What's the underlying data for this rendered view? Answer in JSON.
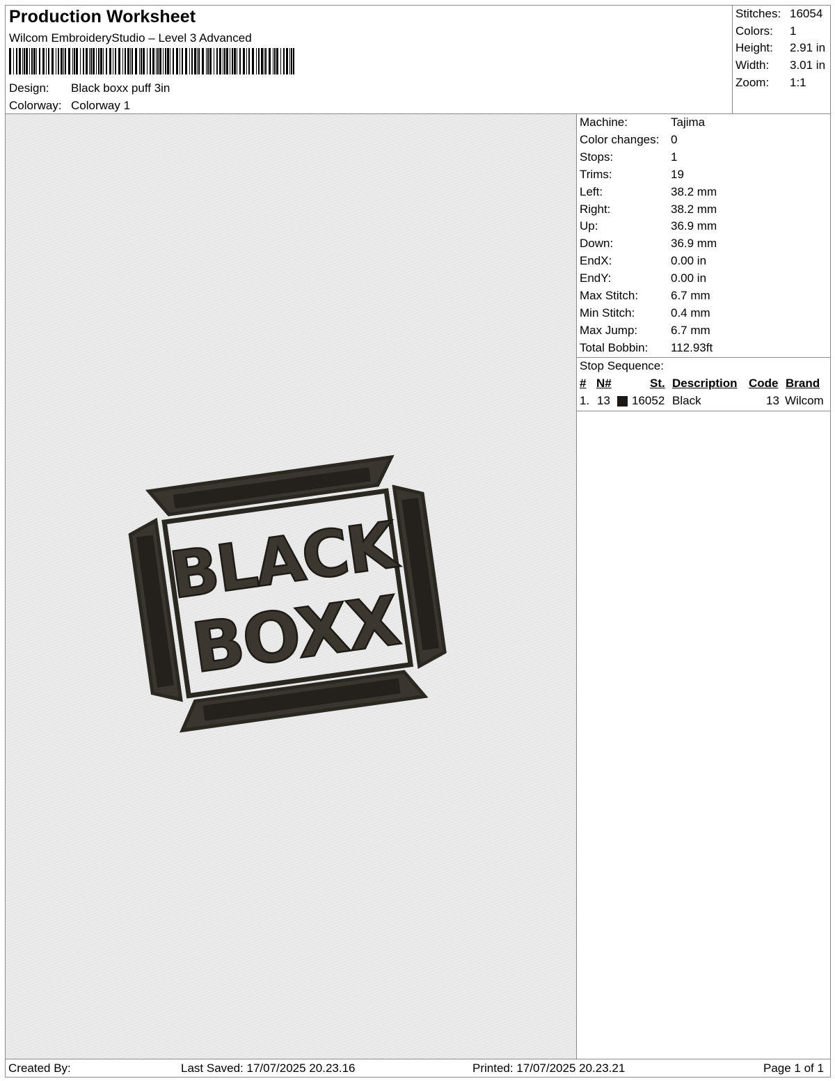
{
  "header": {
    "title": "Production Worksheet",
    "software": "Wilcom EmbroideryStudio – Level 3 Advanced",
    "design_label": "Design:",
    "design_value": "Black boxx puff 3in",
    "colorway_label": "Colorway:",
    "colorway_value": "Colorway 1"
  },
  "summary": [
    {
      "label": "Stitches:",
      "value": "16054"
    },
    {
      "label": "Colors:",
      "value": "1"
    },
    {
      "label": "Height:",
      "value": "2.91 in"
    },
    {
      "label": "Width:",
      "value": "3.01 in"
    },
    {
      "label": "Zoom:",
      "value": "1:1"
    }
  ],
  "details": [
    {
      "label": "Machine:",
      "value": "Tajima"
    },
    {
      "label": "Color changes:",
      "value": "0"
    },
    {
      "label": "Stops:",
      "value": "1"
    },
    {
      "label": "Trims:",
      "value": "19"
    },
    {
      "label": "Left:",
      "value": "38.2 mm"
    },
    {
      "label": "Right:",
      "value": "38.2 mm"
    },
    {
      "label": "Up:",
      "value": "36.9 mm"
    },
    {
      "label": "Down:",
      "value": "36.9 mm"
    },
    {
      "label": "EndX:",
      "value": "0.00 in"
    },
    {
      "label": "EndY:",
      "value": "0.00 in"
    },
    {
      "label": "Max Stitch:",
      "value": "6.7 mm"
    },
    {
      "label": "Min Stitch:",
      "value": "0.4 mm"
    },
    {
      "label": "Max Jump:",
      "value": "6.7 mm"
    },
    {
      "label": "Total Bobbin:",
      "value": "112.93ft"
    }
  ],
  "stop_sequence": {
    "title": "Stop Sequence:",
    "headers": {
      "idx": "#",
      "n": "N#",
      "st": "St.",
      "description": "Description",
      "code": "Code",
      "brand": "Brand"
    },
    "rows": [
      {
        "idx": "1.",
        "n": "13",
        "color": "#1c1816",
        "st": "16052",
        "description": "Black",
        "code": "13",
        "brand": "Wilcom"
      }
    ]
  },
  "design_preview": {
    "line1": "BLACK",
    "line2": "BOXX",
    "thread_color": "#2b2822"
  },
  "footer": {
    "created_by": "Created By:",
    "last_saved": "Last Saved: 17/07/2025 20.23.16",
    "printed": "Printed: 17/07/2025 20.23.21",
    "page": "Page 1 of 1"
  }
}
